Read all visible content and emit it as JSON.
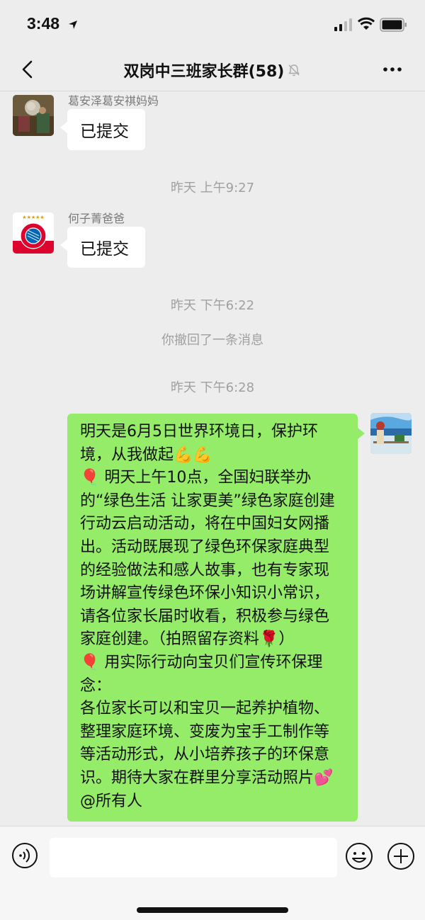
{
  "status_bar": {
    "time": "3:48"
  },
  "header": {
    "title": "双岗中三班家长群(58)"
  },
  "messages": [
    {
      "sender": "葛安泽葛安祺妈妈",
      "text": "已提交"
    },
    {
      "timestamp": "昨天 上午9:27"
    },
    {
      "sender": "何子菁爸爸",
      "text": "已提交"
    },
    {
      "timestamp": "昨天 下午6:22"
    },
    {
      "system": "你撤回了一条消息"
    },
    {
      "timestamp": "昨天 下午6:28"
    },
    {
      "text": "明天是6月5日世界环境日，保护环境，从我做起💪💪\n🎈 明天上午10点，全国妇联举办的“绿色生活 让家更美”绿色家庭创建行动云启动活动，将在中国妇女网播出。活动既展现了绿色环保家庭典型的经验做法和感人故事，也有专家现场讲解宣传绿色环保小知识小常识，请各位家长届时收看，积极参与绿色家庭创建。（拍照留存资料🌹）\n🎈 用实际行动向宝贝们宣传环保理念：\n各位家长可以和宝贝一起养护植物、整理家庭环境、变废为宝手工制作等等活动形式，从小培养孩子的环保意识。期待大家在群里分享活动照片💕 @所有人"
    }
  ],
  "colors": {
    "self_bubble": "#95ec69",
    "other_bubble": "#ffffff",
    "background": "#ededed"
  },
  "icons": [
    "location-arrow-icon",
    "signal-icon",
    "wifi-icon",
    "battery-icon",
    "back-icon",
    "mute-icon",
    "more-icon",
    "voice-icon",
    "emoji-icon",
    "plus-icon"
  ]
}
